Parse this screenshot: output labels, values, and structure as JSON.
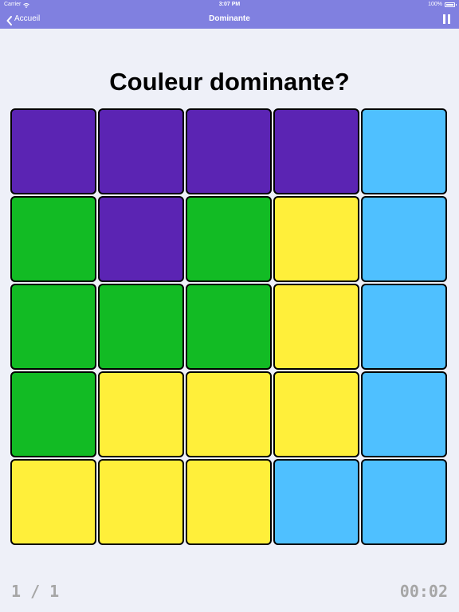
{
  "status_bar": {
    "carrier": "Carrier",
    "time": "3:07 PM",
    "battery": "100%"
  },
  "nav": {
    "back_label": "Accueil",
    "title": "Dominante",
    "back_icon": "chevron-left-icon",
    "pause_icon": "pause-icon"
  },
  "question": "Couleur dominante?",
  "colors": {
    "header": "#8080e0",
    "background": "#eef0f8",
    "purple": "#5b24b3",
    "blue": "#4fc0ff",
    "green": "#12bb24",
    "yellow": "#ffef3a"
  },
  "grid": {
    "rows": [
      [
        "purple",
        "purple",
        "purple",
        "purple",
        "blue"
      ],
      [
        "green",
        "purple",
        "green",
        "yellow",
        "blue"
      ],
      [
        "green",
        "green",
        "green",
        "yellow",
        "blue"
      ],
      [
        "green",
        "yellow",
        "yellow",
        "yellow",
        "blue"
      ],
      [
        "yellow",
        "yellow",
        "yellow",
        "blue",
        "blue"
      ]
    ]
  },
  "footer": {
    "progress": "1 / 1",
    "timer": "00:02"
  }
}
